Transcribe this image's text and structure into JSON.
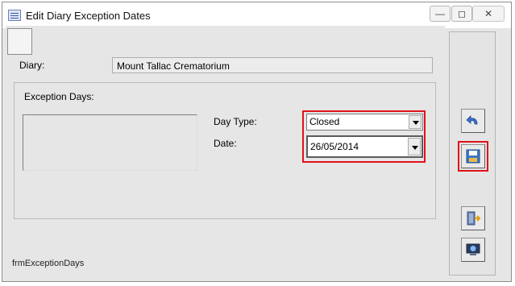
{
  "window": {
    "title": "Edit Diary Exception Dates",
    "minimize_glyph": "—",
    "maximize_glyph": "◻",
    "close_glyph": "✕"
  },
  "form": {
    "diary_label": "Diary:",
    "diary_value": "Mount Tallac Crematorium",
    "exception_days_label": "Exception Days:",
    "day_type_label": "Day Type:",
    "day_type_value": "Closed",
    "date_label": "Date:",
    "date_value": "26/05/2014",
    "footer_name": "frmExceptionDays"
  },
  "toolbar": {
    "icons": [
      "undo-icon",
      "save-icon",
      "exit-door-icon",
      "screen-icon"
    ]
  },
  "colors": {
    "highlight": "#e0121a",
    "background": "#e6e6e6"
  }
}
